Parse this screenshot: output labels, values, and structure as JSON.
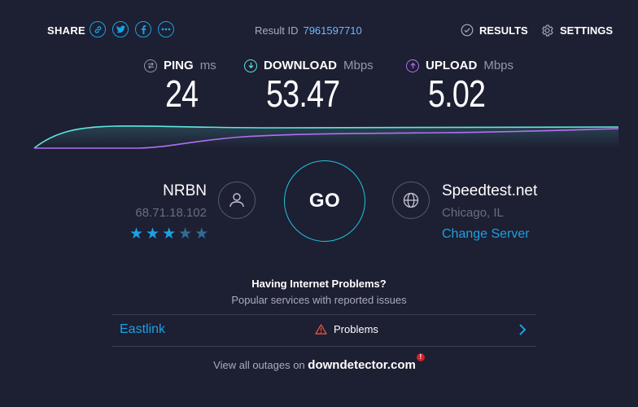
{
  "header": {
    "share_label": "SHARE",
    "result_label": "Result ID",
    "result_id": "7961597710",
    "results_label": "RESULTS",
    "settings_label": "SETTINGS"
  },
  "share_icons": [
    "link-icon",
    "twitter-icon",
    "facebook-icon",
    "more-icon"
  ],
  "metrics": {
    "ping": {
      "label": "PING",
      "unit": "ms",
      "value": "24",
      "icon": "ping-icon"
    },
    "download": {
      "label": "DOWNLOAD",
      "unit": "Mbps",
      "value": "53.47",
      "icon": "download-icon",
      "color": "#5ee8dd"
    },
    "upload": {
      "label": "UPLOAD",
      "unit": "Mbps",
      "value": "5.02",
      "icon": "upload-icon",
      "color": "#b36ff0"
    }
  },
  "provider": {
    "name": "NRBN",
    "ip": "68.71.18.102",
    "rating": 3,
    "rating_max": 5
  },
  "go_label": "GO",
  "server": {
    "name": "Speedtest.net",
    "location": "Chicago, IL",
    "change_label": "Change Server"
  },
  "problems": {
    "title": "Having Internet Problems?",
    "subtitle": "Popular services with reported issues",
    "rows": [
      {
        "service": "Eastlink",
        "status": "Problems"
      }
    ],
    "view_all_prefix": "View all outages on",
    "view_all_site": "downdetector.com",
    "badge": "!"
  },
  "colors": {
    "background": "#1d1f33",
    "accent": "#1ba1e2",
    "download": "#5ee8dd",
    "upload": "#b36ff0",
    "star_on": "#1ba1e2",
    "star_off": "#2f6e93"
  }
}
